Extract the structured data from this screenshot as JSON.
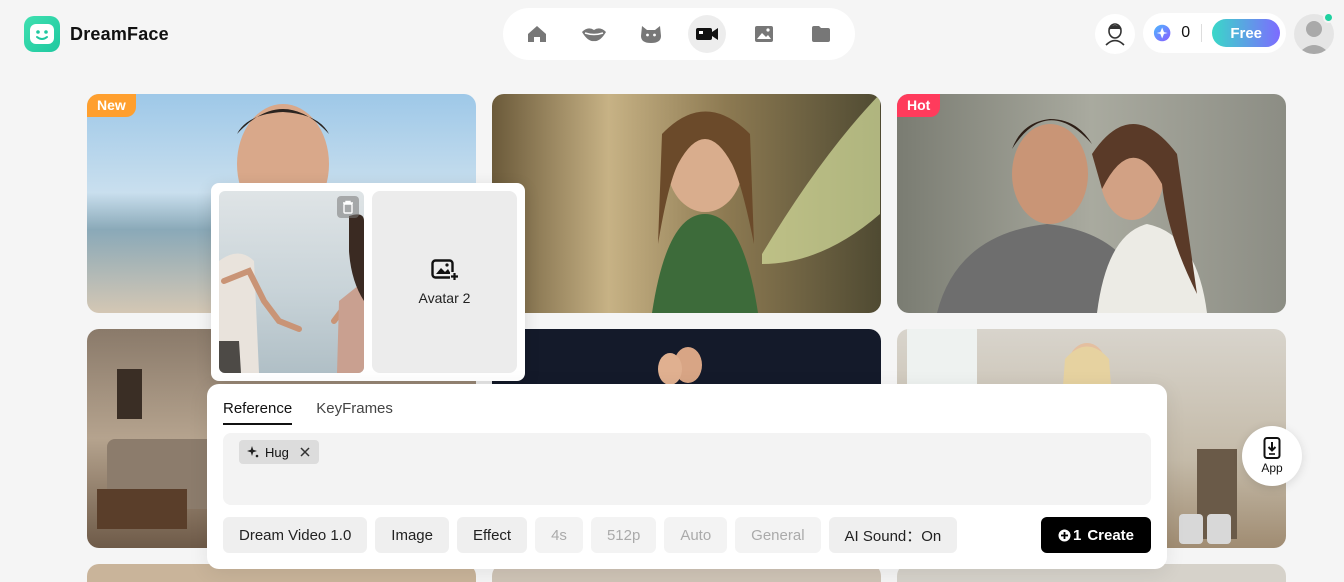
{
  "header": {
    "logo_text": "DreamFace",
    "credits_count": "0",
    "free_label": "Free",
    "nav": [
      {
        "icon": "home-icon"
      },
      {
        "icon": "lips-icon"
      },
      {
        "icon": "cat-icon"
      },
      {
        "icon": "video-camera-icon",
        "active": true
      },
      {
        "icon": "image-icon"
      },
      {
        "icon": "folder-icon"
      }
    ]
  },
  "cards": [
    {
      "badge": "New"
    },
    {
      "badge": ""
    },
    {
      "badge": "Hot"
    }
  ],
  "avatar_popup": {
    "avatar2_label": "Avatar 2"
  },
  "composer": {
    "tabs": [
      "Reference",
      "KeyFrames"
    ],
    "chip_label": "Hug",
    "options": [
      "Dream Video 1.0",
      "Image",
      "Effect",
      "4s",
      "512p",
      "Auto",
      "General",
      "AI Sound：On"
    ],
    "create_count": "1",
    "create_label": "Create"
  },
  "app_button_label": "App",
  "colors": {
    "accent_free_start": "#3ad8c8",
    "accent_free_end": "#7d6bff",
    "badge_new": "#ff9f2e",
    "badge_hot": "#ff3b5c",
    "logo": "#2fd6a8"
  }
}
